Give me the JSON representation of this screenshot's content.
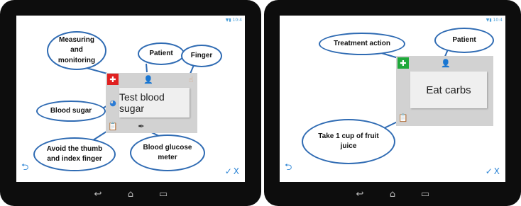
{
  "left_screen": {
    "card_label": "Test blood sugar",
    "callouts": {
      "measuring": "Measuring and monitoring",
      "patient": "Patient",
      "finger": "Finger",
      "blood_sugar": "Blood sugar",
      "avoid": "Avoid the thumb and index finger",
      "meter": "Blood glucose meter"
    },
    "icons": {
      "category": "red-cross-icon",
      "patient": "patient-icon",
      "finger": "finger-icon",
      "blood_sugar": "blood-sugar-icon",
      "note": "clipboard-icon",
      "meter": "glucose-meter-icon"
    }
  },
  "right_screen": {
    "card_label": "Eat carbs",
    "callouts": {
      "treatment": "Treatment action",
      "patient": "Patient",
      "juice": "Take 1 cup of fruit juice"
    },
    "icons": {
      "category": "green-cross-icon",
      "patient": "patient-icon",
      "note": "clipboard-icon"
    }
  },
  "ui": {
    "back_glyph": "⮌",
    "confirm_glyph": "✓",
    "cancel_glyph": "X",
    "nav_back": "↩",
    "nav_home": "⌂",
    "nav_recent": "▭"
  },
  "colors": {
    "bubble_border": "#2f6bb3",
    "accent_blue": "#2f86d6",
    "measuring_red": "#e02020",
    "treatment_green": "#1fa83a",
    "card_gray": "#d2d2d2"
  }
}
